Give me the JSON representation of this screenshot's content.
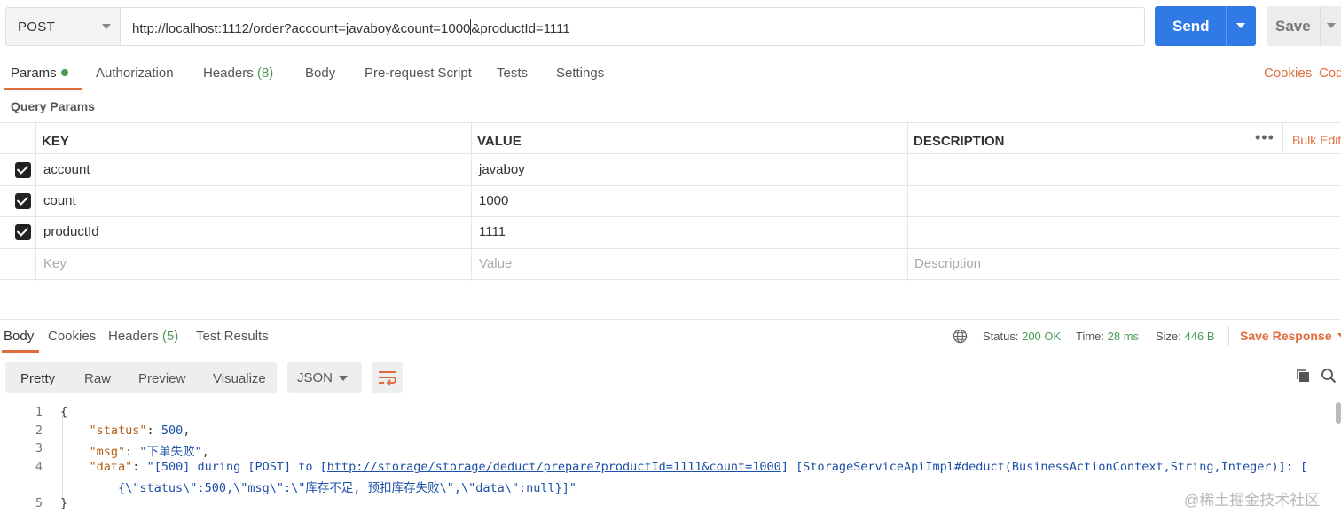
{
  "request": {
    "method": "POST",
    "url_before_cursor": "http://localhost:1112/order?account=javaboy&count=1000",
    "url_after_cursor": "&productId=1111",
    "send_label": "Send",
    "save_label": "Save"
  },
  "tabs": {
    "params": "Params",
    "authorization": "Authorization",
    "headers": "Headers",
    "headers_count": "(8)",
    "body": "Body",
    "pre_request": "Pre-request Script",
    "tests": "Tests",
    "settings": "Settings",
    "cookies": "Cookies",
    "code": "Cod"
  },
  "query_params": {
    "title": "Query Params",
    "headers": {
      "key": "KEY",
      "value": "VALUE",
      "description": "DESCRIPTION"
    },
    "more": "•••",
    "bulk_edit": "Bulk Edit",
    "rows": [
      {
        "key": "account",
        "value": "javaboy",
        "checked": true
      },
      {
        "key": "count",
        "value": "1000",
        "checked": true
      },
      {
        "key": "productId",
        "value": "1111",
        "checked": true
      }
    ],
    "placeholders": {
      "key": "Key",
      "value": "Value",
      "description": "Description"
    }
  },
  "response": {
    "tabs": {
      "body": "Body",
      "cookies": "Cookies",
      "headers": "Headers",
      "headers_count": "(5)",
      "test_results": "Test Results"
    },
    "status_label": "Status:",
    "status_value": "200 OK",
    "time_label": "Time:",
    "time_value": "28 ms",
    "size_label": "Size:",
    "size_value": "446 B",
    "save_response": "Save Response",
    "view_modes": [
      "Pretty",
      "Raw",
      "Preview",
      "Visualize"
    ],
    "format": "JSON"
  },
  "code": {
    "line_numbers": [
      "1",
      "2",
      "3",
      "4",
      "5"
    ],
    "open_brace": "{",
    "close_brace": "}",
    "status_key": "\"status\"",
    "status_value": "500",
    "msg_key": "\"msg\"",
    "msg_value": "\"下单失败\"",
    "data_key": "\"data\"",
    "data_value_pre": "\"[500] during [POST] to [",
    "data_link": "http://storage/storage/deduct/prepare?productId=1111&count=1000",
    "data_value_post": "] [StorageServiceApiImpl#deduct(BusinessActionContext,String,Integer)]: [",
    "data_value_wrap": "{\\\"status\\\":500,\\\"msg\\\":\\\"库存不足, 预扣库存失败\\\",\\\"data\\\":null}]\""
  },
  "watermark": "@稀土掘金技术社区"
}
